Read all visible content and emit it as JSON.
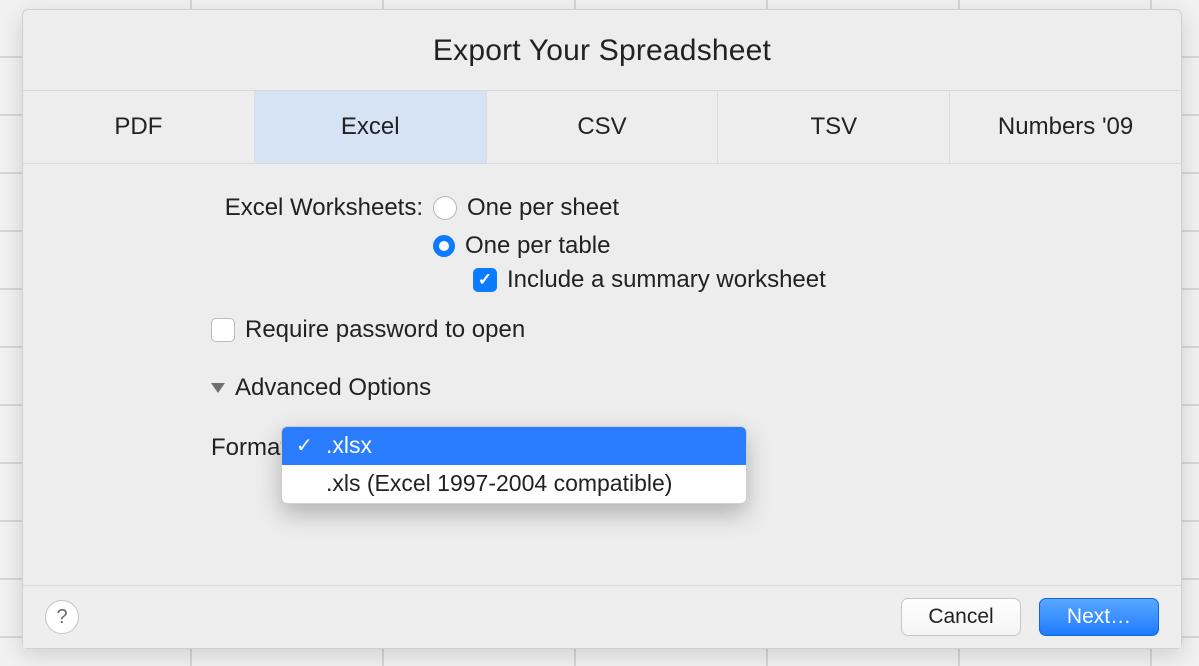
{
  "title": "Export Your Spreadsheet",
  "tabs": {
    "pdf": "PDF",
    "excel": "Excel",
    "csv": "CSV",
    "tsv": "TSV",
    "numbers09": "Numbers '09"
  },
  "worksheets": {
    "label": "Excel Worksheets:",
    "opt_sheet": "One per sheet",
    "opt_table": "One per table",
    "summary_label": "Include a summary worksheet"
  },
  "require_password_label": "Require password to open",
  "advanced_label": "Advanced Options",
  "format": {
    "label": "Format",
    "option_xlsx": ".xlsx",
    "option_xls": ".xls (Excel 1997-2004 compatible)"
  },
  "footer": {
    "help": "?",
    "cancel": "Cancel",
    "next": "Next…"
  }
}
